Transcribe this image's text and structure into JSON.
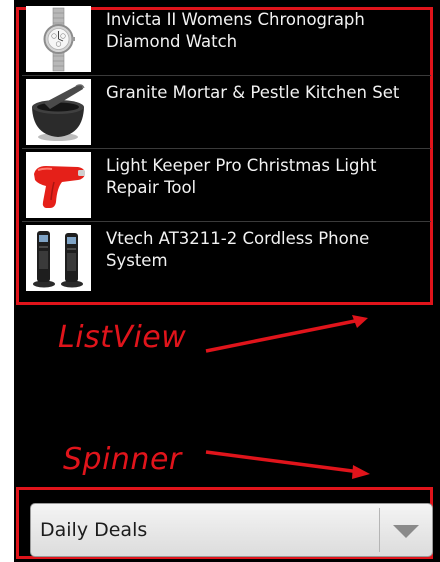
{
  "listview": {
    "items": [
      {
        "label": "Invicta II Womens Chronograph Diamond Watch",
        "icon": "watch-icon"
      },
      {
        "label": "Granite Mortar & Pestle Kitchen Set",
        "icon": "mortar-pestle-icon"
      },
      {
        "label": "Light Keeper Pro Christmas Light Repair Tool",
        "icon": "repair-tool-icon"
      },
      {
        "label": "Vtech AT3211-2 Cordless Phone System",
        "icon": "cordless-phone-icon"
      }
    ]
  },
  "annotations": {
    "listview_label": "ListView",
    "spinner_label": "Spinner",
    "color": "#e0141b"
  },
  "spinner": {
    "selected": "Daily Deals",
    "icon": "chevron-down-icon"
  }
}
